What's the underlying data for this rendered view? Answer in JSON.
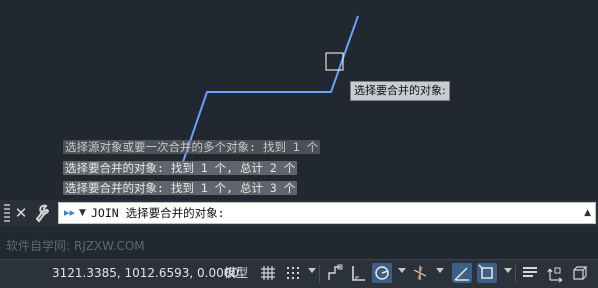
{
  "history": [
    "选择源对象或要一次合并的多个对象: 找到 1 个",
    "选择要合并的对象: 找到 1 个, 总计 2 个",
    "选择要合并的对象: 找到 1 个, 总计 3 个"
  ],
  "tooltip": "选择要合并的对象:",
  "command": {
    "text": "JOIN 选择要合并的对象:"
  },
  "watermark": "软件自学网: RJZXW.COM",
  "status": {
    "coordinates": "3121.3385, 1012.6593, 0.0000",
    "model_label": "模型"
  },
  "icons": {
    "close": "close-icon",
    "customize": "wrench-icon",
    "grid": "grid-icon",
    "snap": "snap-icon",
    "infer": "infer-constraints-icon",
    "ortho": "ortho-icon",
    "polar": "polar-tracking-icon",
    "isodraft": "isometric-drafting-icon",
    "osnap_track": "object-snap-tracking-icon",
    "osnap": "object-snap-icon",
    "lineweight": "lineweight-icon",
    "annotation_scale": "annotation-scale-icon",
    "workspace": "workspace-icon"
  },
  "colors": {
    "canvas": "#212830",
    "polyline": "#6aa0ff",
    "active_toggle": "#3d5e85",
    "command_prompt_arrow": "#3c7fd6"
  }
}
